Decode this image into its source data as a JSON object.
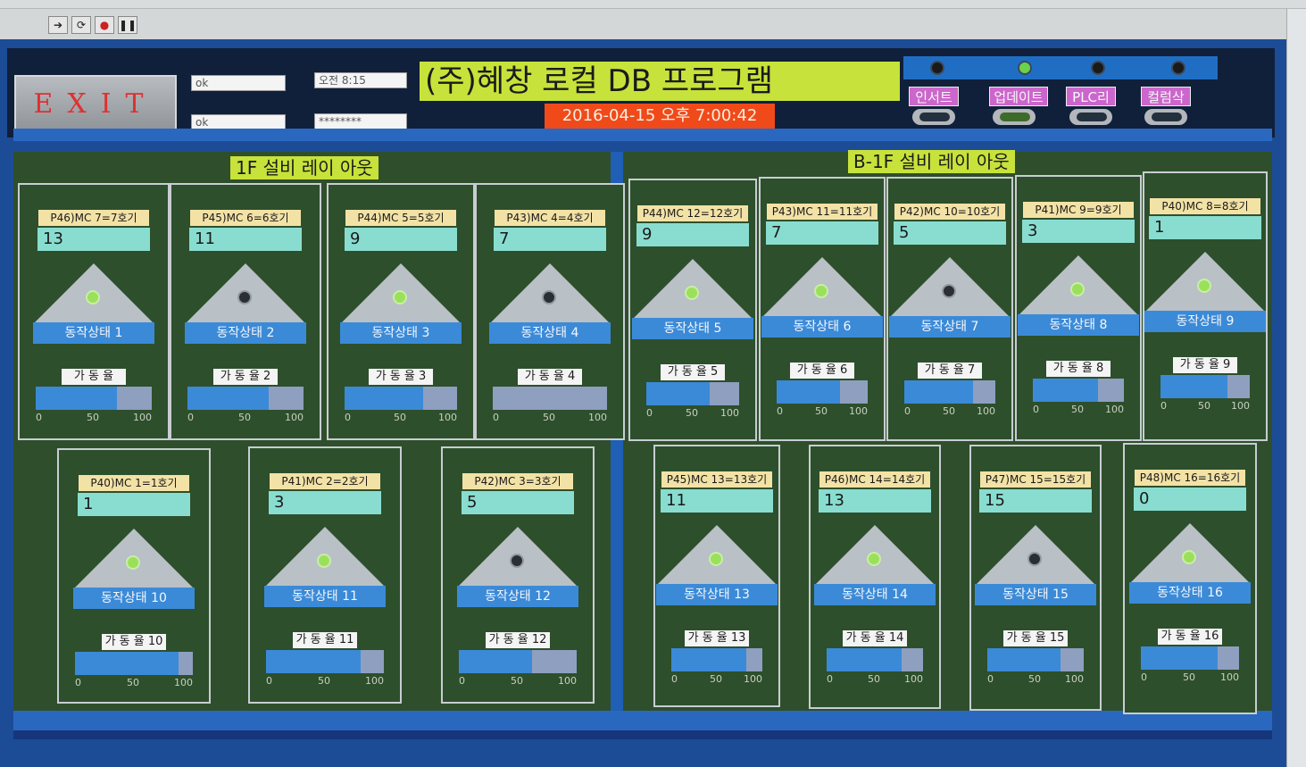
{
  "header": {
    "exit_label": "EXIT",
    "field1": "ok",
    "field2": "ok",
    "time": "오전 8:15",
    "password_mask": "********",
    "title": "(주)혜창 로컬 DB 프로그램",
    "datetime": "2016-04-15 오후 7:00:42"
  },
  "controls": [
    {
      "label": "인서트",
      "lamp_on": false
    },
    {
      "label": "업데이트",
      "lamp_on": true
    },
    {
      "label": "PLC리셋",
      "lamp_on": false
    },
    {
      "label": "컬럼삭제",
      "lamp_on": false
    }
  ],
  "areas": {
    "f1_title": "1F 설비 레이 아웃",
    "b1_title": "B-1F 설비 레이 아웃"
  },
  "scale": {
    "min": "0",
    "mid": "50",
    "max": "100"
  },
  "machines": [
    {
      "name": "P46)MC 7=7호기",
      "value": "13",
      "state": "동작상태  1",
      "rate_label": "가 동 율",
      "lamp_on": true,
      "rate": 0.7
    },
    {
      "name": "P45)MC 6=6호기",
      "value": "11",
      "state": "동작상태  2",
      "rate_label": "가 동 율 2",
      "lamp_on": false,
      "rate": 0.7
    },
    {
      "name": "P44)MC 5=5호기",
      "value": "9",
      "state": "동작상태  3",
      "rate_label": "가 동 율 3",
      "lamp_on": true,
      "rate": 0.7
    },
    {
      "name": "P43)MC 4=4호기",
      "value": "7",
      "state": "동작상태  4",
      "rate_label": "가 동 율 4",
      "lamp_on": false,
      "rate": 0.0
    },
    {
      "name": "P44)MC 12=12호기",
      "value": "9",
      "state": "동작상태  5",
      "rate_label": "가 동 율 5",
      "lamp_on": true,
      "rate": 0.68
    },
    {
      "name": "P43)MC 11=11호기",
      "value": "7",
      "state": "동작상태  6",
      "rate_label": "가 동 율 6",
      "lamp_on": true,
      "rate": 0.7
    },
    {
      "name": "P42)MC 10=10호기",
      "value": "5",
      "state": "동작상태  7",
      "rate_label": "가 동 율 7",
      "lamp_on": false,
      "rate": 0.75
    },
    {
      "name": "P41)MC 9=9호기",
      "value": "3",
      "state": "동작상태  8",
      "rate_label": "가 동 율 8",
      "lamp_on": true,
      "rate": 0.72
    },
    {
      "name": "P40)MC 8=8호기",
      "value": "1",
      "state": "동작상태  9",
      "rate_label": "가 동 율 9",
      "lamp_on": true,
      "rate": 0.75
    },
    {
      "name": "P40)MC 1=1호기",
      "value": "1",
      "state": "동작상태  10",
      "rate_label": "가 동 율 10",
      "lamp_on": true,
      "rate": 0.88
    },
    {
      "name": "P41)MC 2=2호기",
      "value": "3",
      "state": "동작상태  11",
      "rate_label": "가 동 율 11",
      "lamp_on": true,
      "rate": 0.8
    },
    {
      "name": "P42)MC 3=3호기",
      "value": "5",
      "state": "동작상태  12",
      "rate_label": "가 동 율 12",
      "lamp_on": false,
      "rate": 0.62
    },
    {
      "name": "P45)MC 13=13호기",
      "value": "11",
      "state": "동작상태  13",
      "rate_label": "가 동 율 13",
      "lamp_on": true,
      "rate": 0.82
    },
    {
      "name": "P46)MC 14=14호기",
      "value": "13",
      "state": "동작상태  14",
      "rate_label": "가 동 율 14",
      "lamp_on": true,
      "rate": 0.78
    },
    {
      "name": "P47)MC 15=15호기",
      "value": "15",
      "state": "동작상태  15",
      "rate_label": "가 동 율 15",
      "lamp_on": false,
      "rate": 0.76
    },
    {
      "name": "P48)MC 16=16호기",
      "value": "0",
      "state": "동작상태  16",
      "rate_label": "가 동 율 16",
      "lamp_on": true,
      "rate": 0.78
    }
  ]
}
